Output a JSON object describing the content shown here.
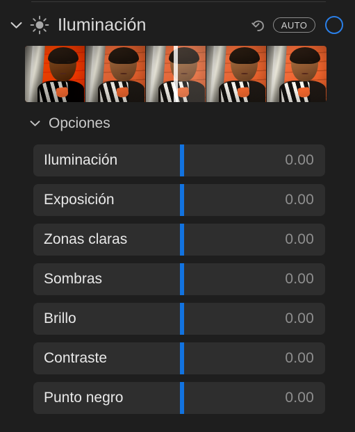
{
  "header": {
    "title": "Iluminación",
    "disclosure_icon": "chevron-down-icon",
    "section_icon": "brightness-sun-icon",
    "reset_icon": "undo-arrow-icon",
    "auto_label": "AUTO",
    "toggle_icon": "circle-toggle-icon",
    "accent_color": "#2a7fe8"
  },
  "filmstrip": {
    "name": "lighting-variations-filmstrip",
    "count": 5,
    "selected_index": 2,
    "selection_position_pct": 50,
    "thumbnails": [
      {
        "label": "variation-1"
      },
      {
        "label": "variation-2"
      },
      {
        "label": "variation-3"
      },
      {
        "label": "variation-4"
      },
      {
        "label": "variation-5"
      }
    ]
  },
  "options": {
    "title": "Opciones",
    "disclosure_icon": "chevron-down-icon",
    "slider_handle_color": "#1273e0",
    "handle_position_pct": 51,
    "rows": [
      {
        "label": "Iluminación",
        "value": "0.00"
      },
      {
        "label": "Exposición",
        "value": "0.00"
      },
      {
        "label": "Zonas claras",
        "value": "0.00"
      },
      {
        "label": "Sombras",
        "value": "0.00"
      },
      {
        "label": "Brillo",
        "value": "0.00"
      },
      {
        "label": "Contraste",
        "value": "0.00"
      },
      {
        "label": "Punto negro",
        "value": "0.00"
      }
    ]
  }
}
